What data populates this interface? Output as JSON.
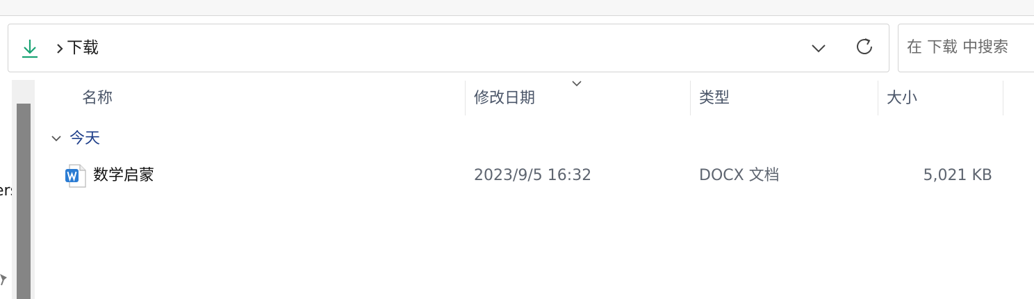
{
  "address_bar": {
    "path": "下载",
    "location_icon": "download-icon",
    "dropdown_icon": "chevron-down-icon",
    "refresh_icon": "refresh-icon"
  },
  "search": {
    "placeholder": "在 下载 中搜索"
  },
  "nav_pane": {
    "partial_text": "ers"
  },
  "columns": {
    "name": "名称",
    "date": "修改日期",
    "type": "类型",
    "size": "大小"
  },
  "groups": [
    {
      "label": "今天",
      "files": [
        {
          "name": "数学启蒙",
          "date": "2023/9/5 16:32",
          "type": "DOCX 文档",
          "size": "5,021 KB",
          "icon": "word-document-icon"
        }
      ]
    }
  ],
  "colors": {
    "accent_green": "#1aa374",
    "group_blue": "#1f3f8a",
    "word_blue": "#2b7cd3"
  }
}
